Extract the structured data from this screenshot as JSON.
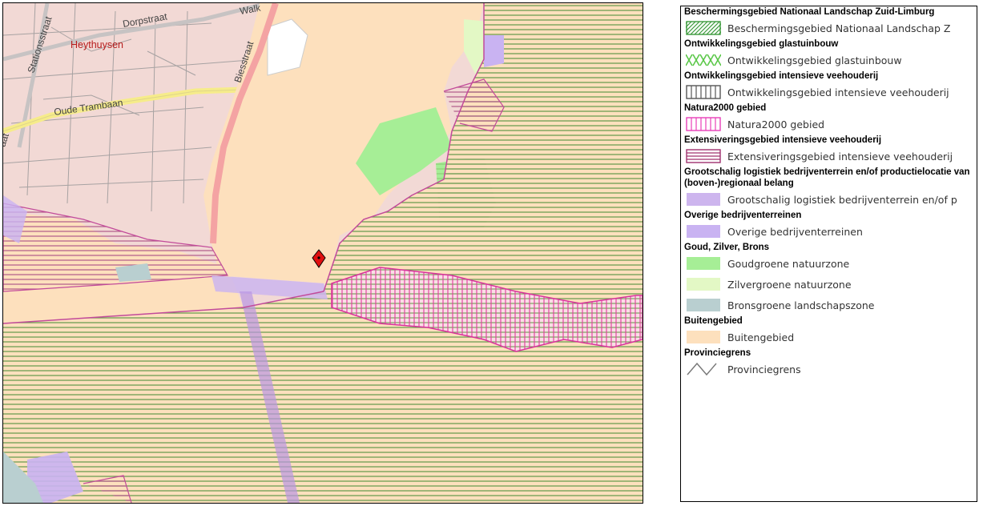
{
  "map": {
    "place_label": "Heythuysen",
    "streets": [
      "Dorpstraat",
      "Stationsstraat",
      "Oude Trambaan",
      "Biesstraat",
      "Walk",
      "aat"
    ]
  },
  "legend": {
    "groups": [
      {
        "heading": "Beschermingsgebied Nationaal Landschap Zuid-Limburg",
        "items": [
          {
            "label": "Beschermingsgebied Nationaal Landschap Z",
            "symbol": "diagonal-hatch-green",
            "color": "#3c9a3c"
          }
        ]
      },
      {
        "heading": "Ontwikkelingsgebied glastuinbouw",
        "items": [
          {
            "label": "Ontwikkelingsgebied glastuinbouw",
            "symbol": "cross-hatch-green",
            "color": "#5cc84a"
          }
        ]
      },
      {
        "heading": "Ontwikkelingsgebied intensieve veehouderij",
        "items": [
          {
            "label": "Ontwikkelingsgebied intensieve veehouderij",
            "symbol": "vertical-hatch-grey",
            "color": "#555555"
          }
        ]
      },
      {
        "heading": "Natura2000 gebied",
        "items": [
          {
            "label": "Natura2000 gebied",
            "symbol": "vertical-hatch-pink",
            "color": "#e83fb8"
          }
        ]
      },
      {
        "heading": "Extensiveringsgebied intensieve veehouderij",
        "items": [
          {
            "label": "Extensiveringsgebied intensieve veehouderij",
            "symbol": "horizontal-hatch-purple",
            "color": "#a0306e"
          }
        ]
      },
      {
        "heading": "Grootschalig logistiek bedrijventerrein en/of productielocatie van (boven-)regionaal belang",
        "items": [
          {
            "label": "Grootschalig logistiek bedrijventerrein en/of p",
            "symbol": "fill",
            "color": "#cdb5ee"
          }
        ]
      },
      {
        "heading": "Overige bedrijventerreinen",
        "items": [
          {
            "label": "Overige bedrijventerreinen",
            "symbol": "fill",
            "color": "#c9b3f2"
          }
        ]
      },
      {
        "heading": "Goud, Zilver, Brons",
        "items": [
          {
            "label": "Goudgroene natuurzone",
            "symbol": "fill",
            "color": "#a6ee96"
          },
          {
            "label": "Zilvergroene natuurzone",
            "symbol": "fill",
            "color": "#e3f8c5"
          },
          {
            "label": "Bronsgroene landschapszone",
            "symbol": "fill",
            "color": "#b9cfd0"
          }
        ]
      },
      {
        "heading": "Buitengebied",
        "items": [
          {
            "label": "Buitengebied",
            "symbol": "fill",
            "color": "#fde0bd"
          }
        ]
      },
      {
        "heading": "Provinciegrens",
        "items": [
          {
            "label": "Provinciegrens",
            "symbol": "line-grey",
            "color": "#777777"
          }
        ]
      }
    ]
  }
}
